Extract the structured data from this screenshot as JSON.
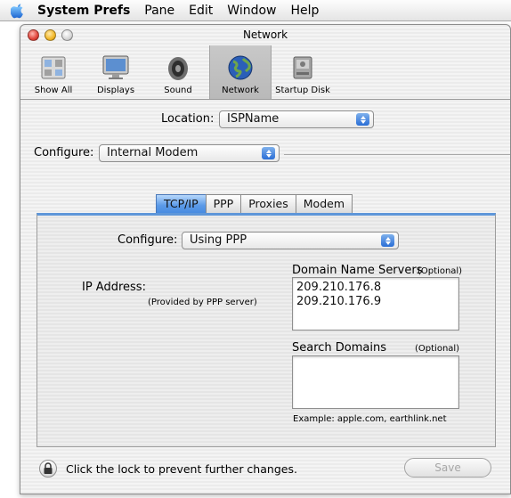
{
  "menubar": {
    "app_name": "System Prefs",
    "items": [
      "Pane",
      "Edit",
      "Window",
      "Help"
    ]
  },
  "window": {
    "title": "Network"
  },
  "toolbar": {
    "items": [
      {
        "label": "Show All",
        "icon": "show-all-icon"
      },
      {
        "label": "Displays",
        "icon": "displays-icon"
      },
      {
        "label": "Sound",
        "icon": "sound-icon"
      },
      {
        "label": "Network",
        "icon": "network-icon",
        "selected": true
      },
      {
        "label": "Startup Disk",
        "icon": "startup-disk-icon"
      }
    ]
  },
  "location": {
    "label": "Location:",
    "value": "ISPName"
  },
  "configure_interface": {
    "label": "Configure:",
    "value": "Internal Modem"
  },
  "tabs": [
    {
      "label": "TCP/IP",
      "active": true
    },
    {
      "label": "PPP"
    },
    {
      "label": "Proxies"
    },
    {
      "label": "Modem"
    }
  ],
  "tcpip": {
    "configure_label": "Configure:",
    "configure_value": "Using PPP",
    "ip_address_label": "IP Address:",
    "ip_address_note": "(Provided by PPP server)",
    "dns_label": "Domain Name Servers",
    "dns_optional": "(Optional)",
    "dns_servers": [
      "209.210.176.8",
      "209.210.176.9"
    ],
    "search_domains_label": "Search Domains",
    "search_domains_optional": "(Optional)",
    "search_domains_value": "",
    "example_text": "Example: apple.com, earthlink.net"
  },
  "footer": {
    "lock_text": "Click the lock to prevent further changes.",
    "save_label": "Save"
  },
  "colors": {
    "accent_blue": "#5c9be8",
    "window_bg": "#ececec"
  }
}
